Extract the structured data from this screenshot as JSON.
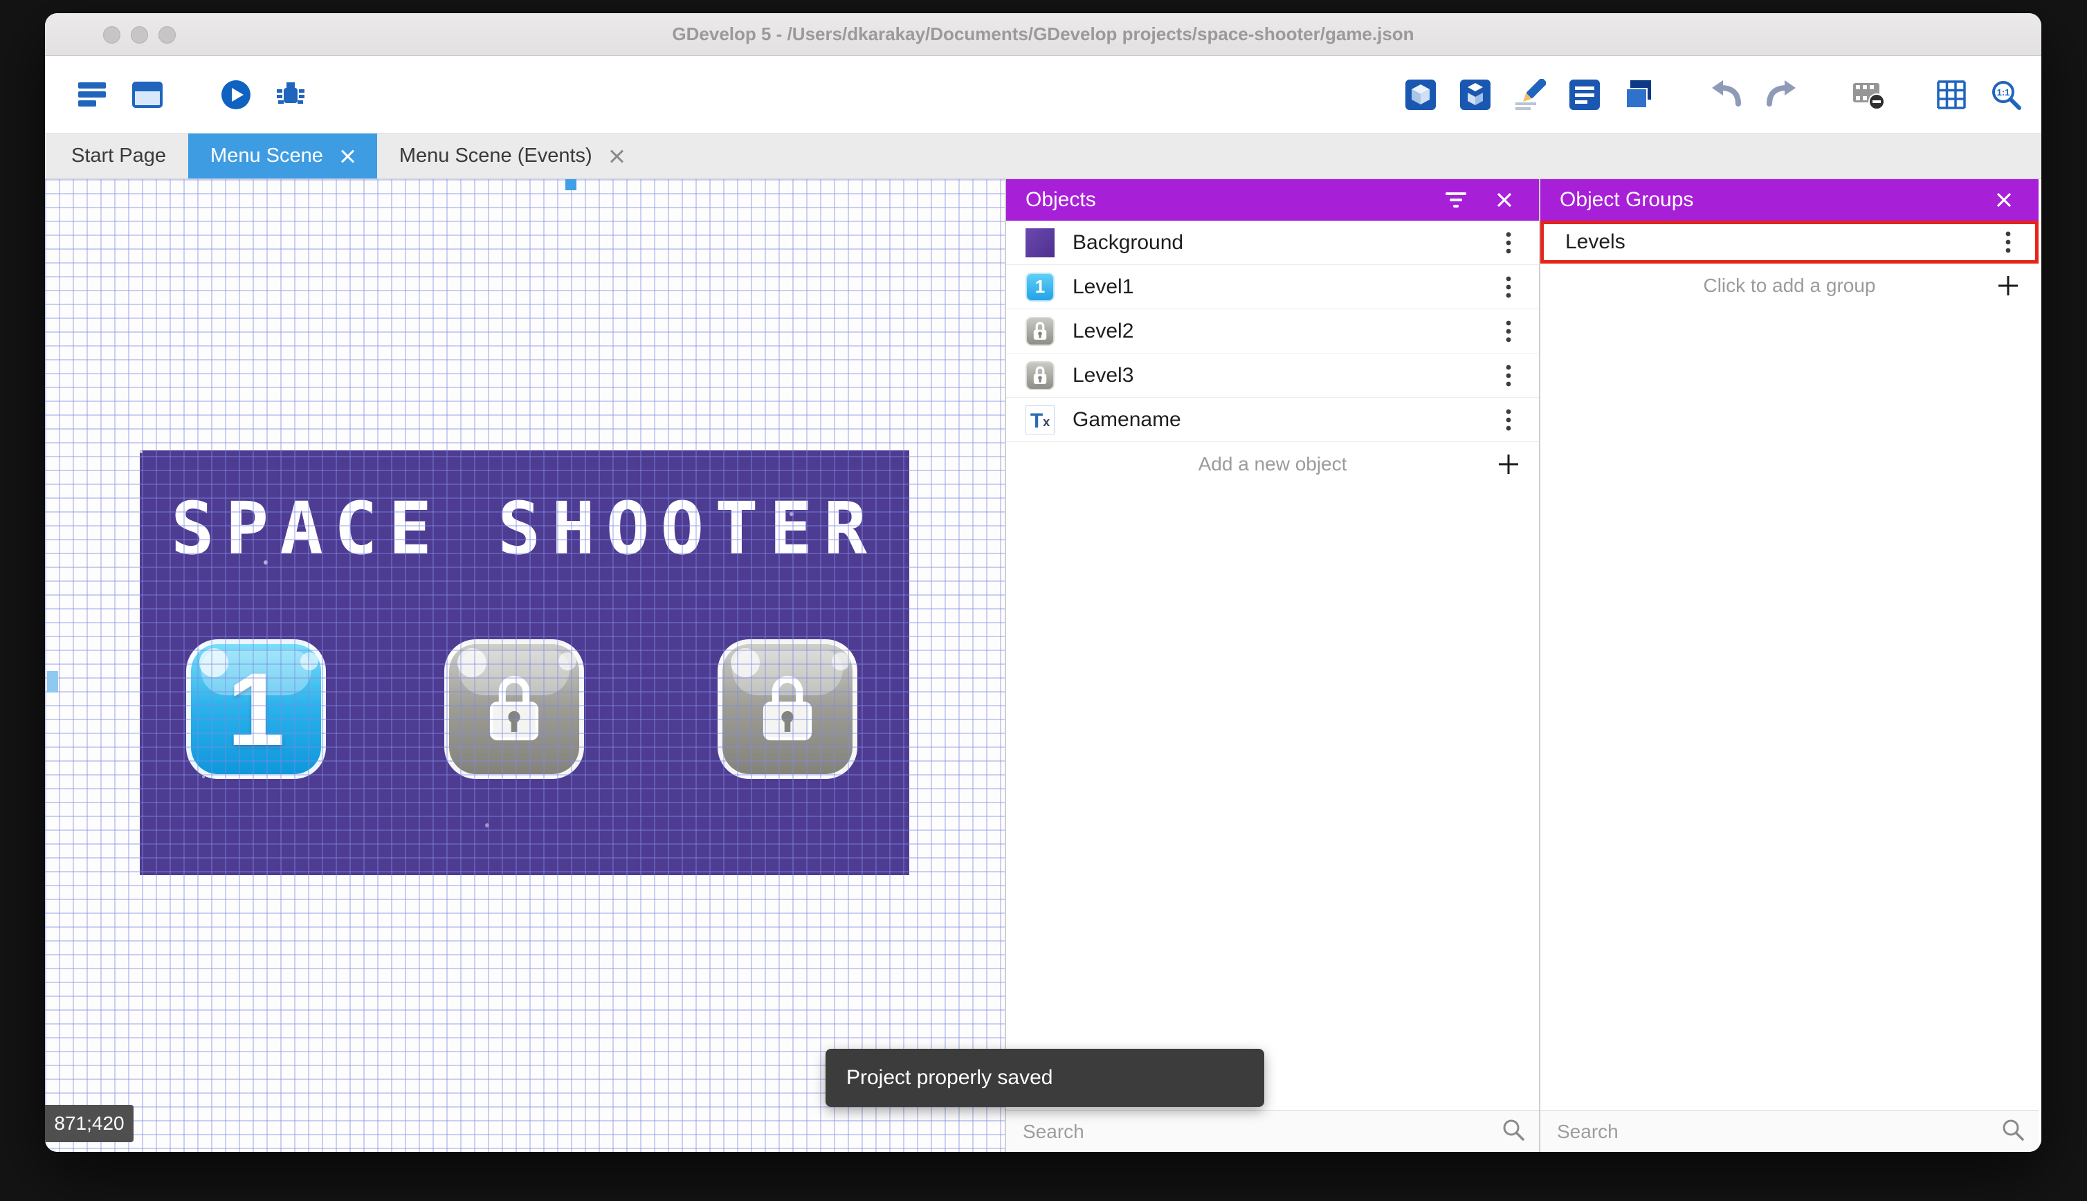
{
  "window": {
    "title": "GDevelop 5 - /Users/dkarakay/Documents/GDevelop projects/space-shooter/game.json"
  },
  "toolbar": {
    "left_icons": [
      "project-manager",
      "scene-editor",
      "preview-play",
      "debug"
    ],
    "right_icons": [
      "objects-editor",
      "instances-list",
      "edit-scene",
      "events-sheet",
      "layers",
      "undo",
      "redo",
      "render-mask",
      "grid",
      "zoom-1-1"
    ],
    "zoom_label": "1:1"
  },
  "tabs": [
    {
      "label": "Start Page",
      "active": false,
      "closable": false
    },
    {
      "label": "Menu Scene",
      "active": true,
      "closable": true
    },
    {
      "label": "Menu Scene (Events)",
      "active": false,
      "closable": true
    }
  ],
  "canvas": {
    "cursor_position": "871;420",
    "scene_title": "SPACE SHOOTER",
    "level_button_label": "1",
    "level_buttons": [
      "unlocked-1",
      "locked",
      "locked"
    ]
  },
  "objects_panel": {
    "title": "Objects",
    "items": [
      {
        "name": "Background",
        "icon": "background-swatch"
      },
      {
        "name": "Level1",
        "icon": "level1-button",
        "badge": "1"
      },
      {
        "name": "Level2",
        "icon": "lock-button"
      },
      {
        "name": "Level3",
        "icon": "lock-button"
      },
      {
        "name": "Gamename",
        "icon": "text-object",
        "icon_t": "T",
        "icon_x": "x"
      }
    ],
    "add_label": "Add a new object",
    "search_placeholder": "Search"
  },
  "groups_panel": {
    "title": "Object Groups",
    "items": [
      {
        "name": "Levels",
        "highlighted": true
      }
    ],
    "add_label": "Click to add a group",
    "search_placeholder": "Search"
  },
  "toast": {
    "message": "Project properly saved"
  },
  "colors": {
    "panel_header": "#a81fd8",
    "active_tab": "#3d9ce2",
    "highlight_annotation": "#e4261a",
    "scene_background": "#4e3c92"
  }
}
